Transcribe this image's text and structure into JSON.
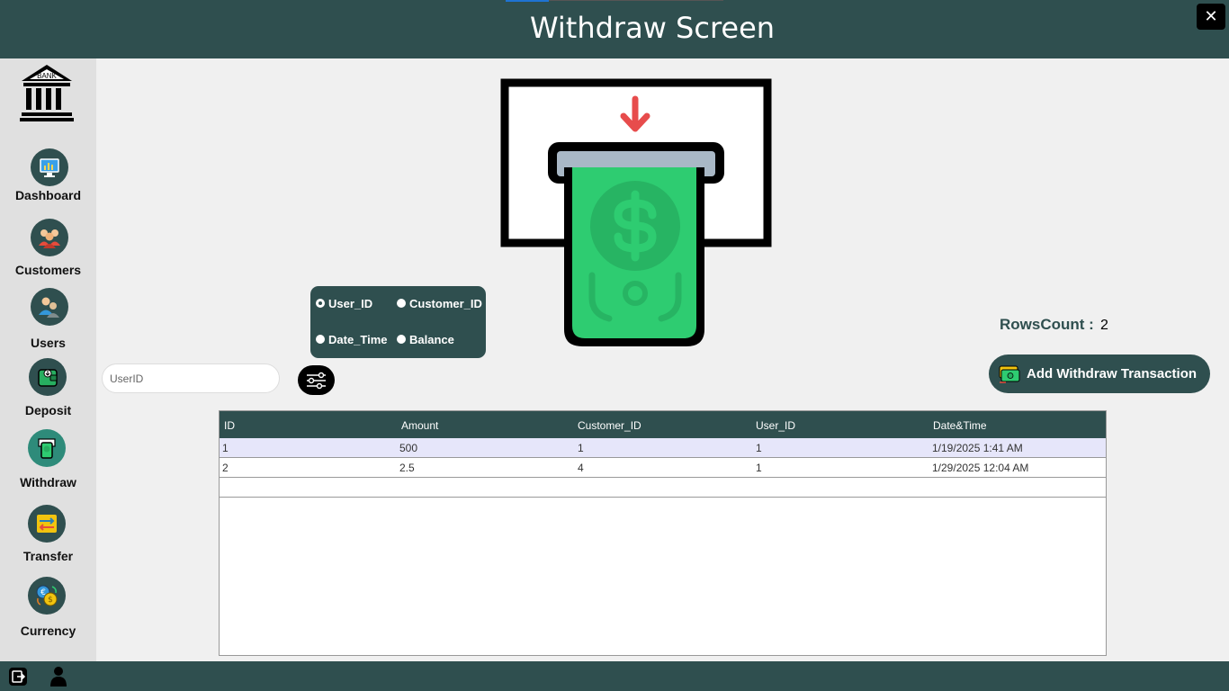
{
  "header": {
    "title": "Withdraw Screen",
    "close_label": "✕"
  },
  "sidebar": {
    "logo_text": "BANK",
    "items": [
      {
        "label": "Dashboard",
        "icon": "dashboard-monitor-icon"
      },
      {
        "label": "Customers",
        "icon": "customers-group-icon"
      },
      {
        "label": "Users",
        "icon": "users-icon"
      },
      {
        "label": "Deposit",
        "icon": "deposit-wallet-icon"
      },
      {
        "label": "Withdraw",
        "icon": "withdraw-atm-icon"
      },
      {
        "label": "Transfer",
        "icon": "transfer-arrows-icon"
      },
      {
        "label": "Currency",
        "icon": "currency-exchange-icon"
      }
    ]
  },
  "filter": {
    "options": [
      "User_ID",
      "Customer_ID",
      "Date_Time",
      "Balance"
    ],
    "selected": "User_ID"
  },
  "search": {
    "placeholder": "UserID",
    "value": ""
  },
  "rows_count": {
    "label": "RowsCount :",
    "value": "2"
  },
  "add_button": {
    "label": "Add Withdraw Transaction"
  },
  "table": {
    "columns": [
      "ID",
      "Amount",
      "Customer_ID",
      "User_ID",
      "Date&Time"
    ],
    "rows": [
      [
        "1",
        "500",
        "1",
        "1",
        "1/19/2025 1:41 AM"
      ],
      [
        "2",
        "2.5",
        "4",
        "1",
        "1/29/2025 12:04 AM"
      ]
    ]
  },
  "footer": {
    "icons": [
      "logout-icon",
      "user-profile-icon"
    ]
  },
  "colors": {
    "primary": "#2f4f4f",
    "background": "#f0f0f0",
    "sidebar": "#e0e0e0",
    "money_green": "#2ecc71",
    "arrow_red": "#e74c4c",
    "selected_row": "#e6e6fa"
  }
}
